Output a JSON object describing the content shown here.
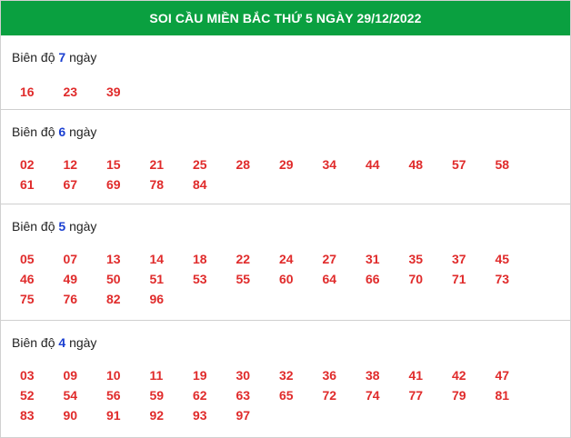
{
  "header": {
    "title": "SOI CẦU MIỀN BẮC THỨ 5 NGÀY 29/12/2022"
  },
  "groups": [
    {
      "label_prefix": "Biên độ",
      "days": "7",
      "label_suffix": "ngày",
      "numbers": [
        "16",
        "23",
        "39"
      ]
    },
    {
      "label_prefix": "Biên độ",
      "days": "6",
      "label_suffix": "ngày",
      "numbers": [
        "02",
        "12",
        "15",
        "21",
        "25",
        "28",
        "29",
        "34",
        "44",
        "48",
        "57",
        "58",
        "61",
        "67",
        "69",
        "78",
        "84"
      ]
    },
    {
      "label_prefix": "Biên độ",
      "days": "5",
      "label_suffix": "ngày",
      "numbers": [
        "05",
        "07",
        "13",
        "14",
        "18",
        "22",
        "24",
        "27",
        "31",
        "35",
        "37",
        "45",
        "46",
        "49",
        "50",
        "51",
        "53",
        "55",
        "60",
        "64",
        "66",
        "70",
        "71",
        "73",
        "75",
        "76",
        "82",
        "96"
      ]
    },
    {
      "label_prefix": "Biên độ",
      "days": "4",
      "label_suffix": "ngày",
      "numbers": [
        "03",
        "09",
        "10",
        "11",
        "19",
        "30",
        "32",
        "36",
        "38",
        "41",
        "42",
        "47",
        "52",
        "54",
        "56",
        "59",
        "62",
        "63",
        "65",
        "72",
        "74",
        "77",
        "79",
        "81",
        "83",
        "90",
        "91",
        "92",
        "93",
        "97"
      ]
    }
  ]
}
